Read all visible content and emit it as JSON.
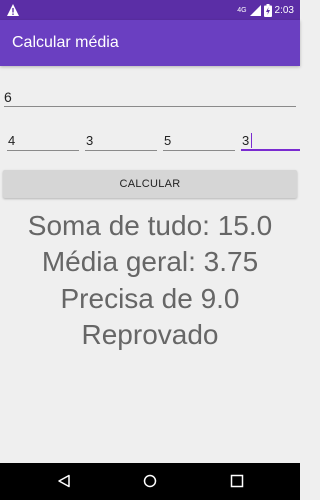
{
  "status_bar": {
    "network": "4G",
    "time": "2:03",
    "icons": [
      "warning-icon",
      "signal-icon",
      "battery-icon"
    ]
  },
  "app_bar": {
    "title": "Calcular média"
  },
  "form": {
    "target_value": "6",
    "grades": [
      "4",
      "3",
      "5",
      "3"
    ],
    "calculate_label": "CALCULAR"
  },
  "results": {
    "sum": "Soma de tudo: 15.0",
    "average": "Média geral: 3.75",
    "needed": "Precisa de 9.0",
    "status": "Reprovado"
  },
  "nav_bar": {
    "icons": [
      "back-icon",
      "home-icon",
      "recents-icon"
    ]
  },
  "colors": {
    "status_bar": "#5b2ea6",
    "app_bar": "#6a3fc1",
    "accent": "#7a2bd0",
    "background": "#efefef",
    "result_text": "#666666"
  }
}
